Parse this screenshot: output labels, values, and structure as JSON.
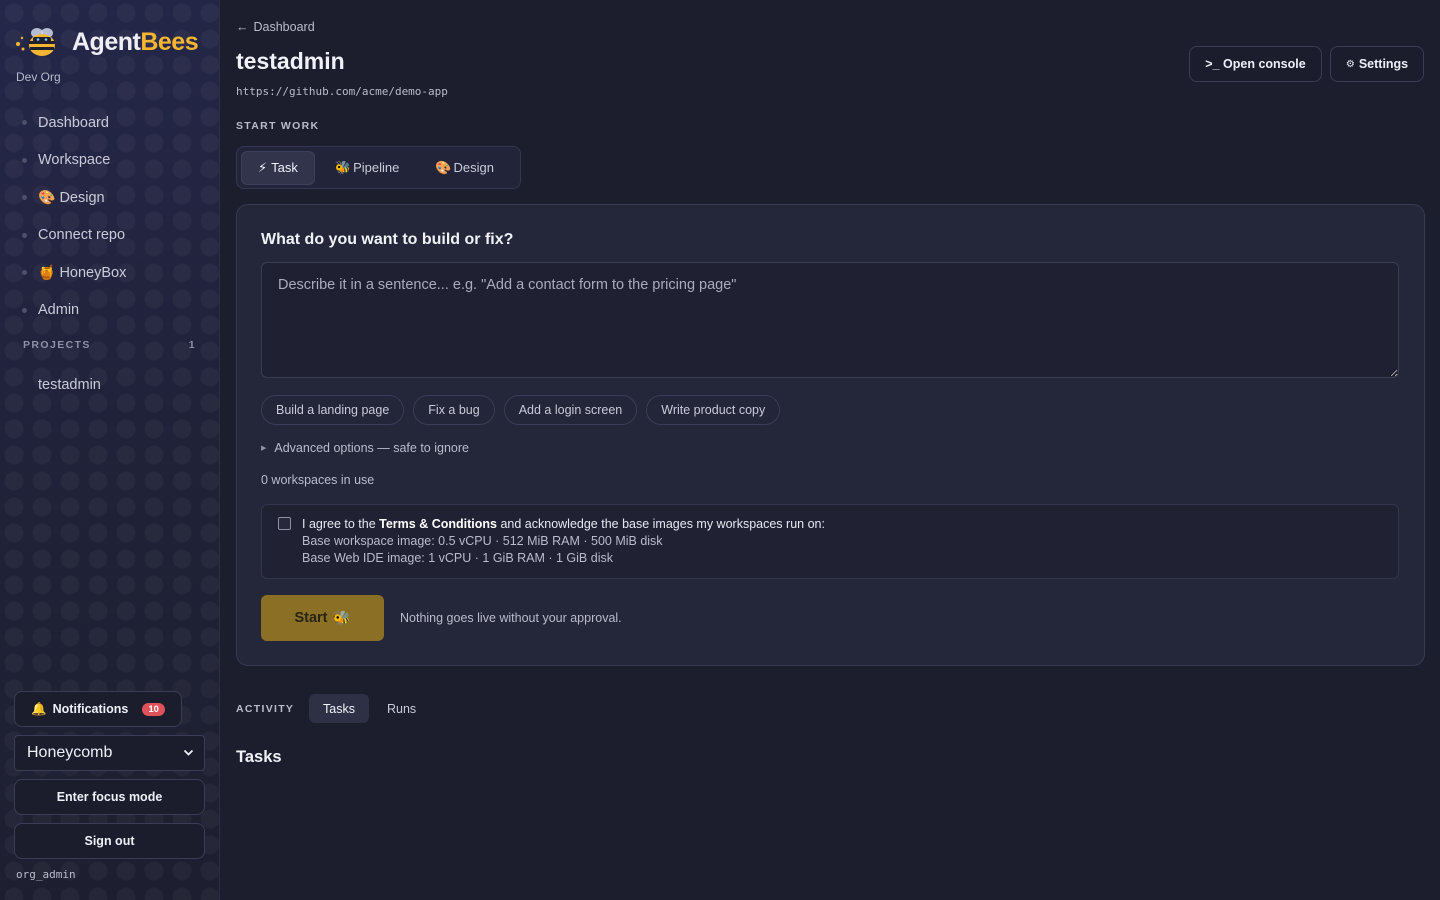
{
  "brand": {
    "name_part1": "Agent",
    "name_part2": "Bees",
    "org": "Dev Org"
  },
  "sidebar": {
    "items": [
      {
        "label": "Dashboard"
      },
      {
        "label": "Workspace"
      },
      {
        "emoji": "🎨",
        "label": "Design"
      },
      {
        "label": "Connect repo"
      },
      {
        "emoji": "🍯",
        "label": "HoneyBox"
      },
      {
        "label": "Admin"
      }
    ],
    "projects_heading": "PROJECTS",
    "projects_count": "1",
    "projects": [
      {
        "label": "testadmin"
      }
    ],
    "notifications": {
      "emoji": "🔔",
      "label": "Notifications",
      "count": "10"
    },
    "theme_select": {
      "value": "Honeycomb",
      "options": [
        "Honeycomb"
      ]
    },
    "focus_mode_label": "Enter focus mode",
    "sign_out_label": "Sign out",
    "user": "org_admin"
  },
  "header": {
    "back_label": "Dashboard",
    "back_arrow": "←",
    "title": "testadmin",
    "repo_url": "https://github.com/acme/demo-app",
    "console_label": ">_ Open console",
    "settings_icon": "⚙",
    "settings_label": "Settings"
  },
  "start_work": {
    "heading": "START WORK",
    "tabs": [
      {
        "emoji": "⚡",
        "label": "Task",
        "active": true
      },
      {
        "emoji": "🐝",
        "label": "Pipeline",
        "active": false
      },
      {
        "emoji": "🎨",
        "label": "Design",
        "active": false
      }
    ]
  },
  "task_card": {
    "title": "What do you want to build or fix?",
    "prompt_placeholder": "Describe it in a sentence... e.g. \"Add a contact form to the pricing page\"",
    "prompt_value": "",
    "suggestions": [
      "Build a landing page",
      "Fix a bug",
      "Add a login screen",
      "Write product copy"
    ],
    "advanced_label": "Advanced options — safe to ignore",
    "workspaces_in_use": "0 workspaces in use",
    "agreement": {
      "checked": false,
      "prefix": "I agree to the ",
      "terms_link": "Terms & Conditions",
      "suffix": " and acknowledge the base images my workspaces run on:",
      "workspace_image": "Base workspace image: 0.5 vCPU · 512 MiB RAM · 500 MiB disk",
      "ide_image": "Base Web IDE image: 1 vCPU · 1 GiB RAM · 1 GiB disk"
    },
    "start_label": "Start",
    "start_emoji": "🐝",
    "start_note": "Nothing goes live without your approval."
  },
  "activity": {
    "heading": "ACTIVITY",
    "tabs": [
      {
        "label": "Tasks",
        "active": true
      },
      {
        "label": "Runs",
        "active": false
      }
    ],
    "section_title": "Tasks"
  },
  "colors": {
    "accent": "#f5b530",
    "start_button": "#8a6f24",
    "badge": "#e0525a",
    "background": "#1c1e2d"
  }
}
